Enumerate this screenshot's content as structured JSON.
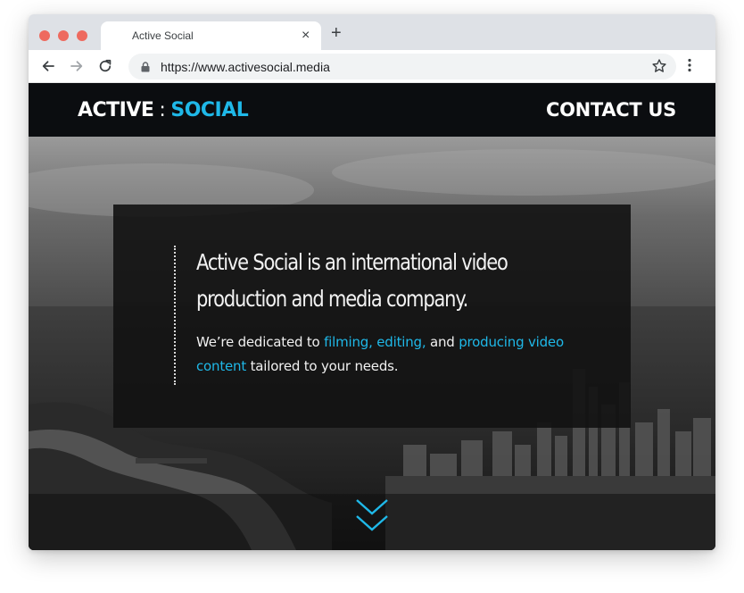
{
  "browser": {
    "tab_title": "Active Social",
    "tab_close": "×",
    "new_tab": "+",
    "url": "https://www.activesocial.media"
  },
  "site": {
    "logo_primary": "ACTIVE",
    "logo_separator": ":",
    "logo_accent": "SOCIAL",
    "contact_label": "CONTACT US",
    "headline": "Active Social is an international video production and media company.",
    "sub_part1": "We’re dedicated to ",
    "sub_highlight1": "filming, editing,",
    "sub_part2": " and ",
    "sub_highlight2": "producing video content",
    "sub_part3": " tailored to your needs."
  },
  "colors": {
    "accent": "#1fb8e8",
    "header_bg": "#0b0d10",
    "traffic_light": "#ee6a5f"
  },
  "icons": [
    "back-arrow-icon",
    "forward-arrow-icon",
    "reload-icon",
    "lock-icon",
    "star-icon",
    "kebab-menu-icon",
    "double-chevron-down-icon"
  ]
}
